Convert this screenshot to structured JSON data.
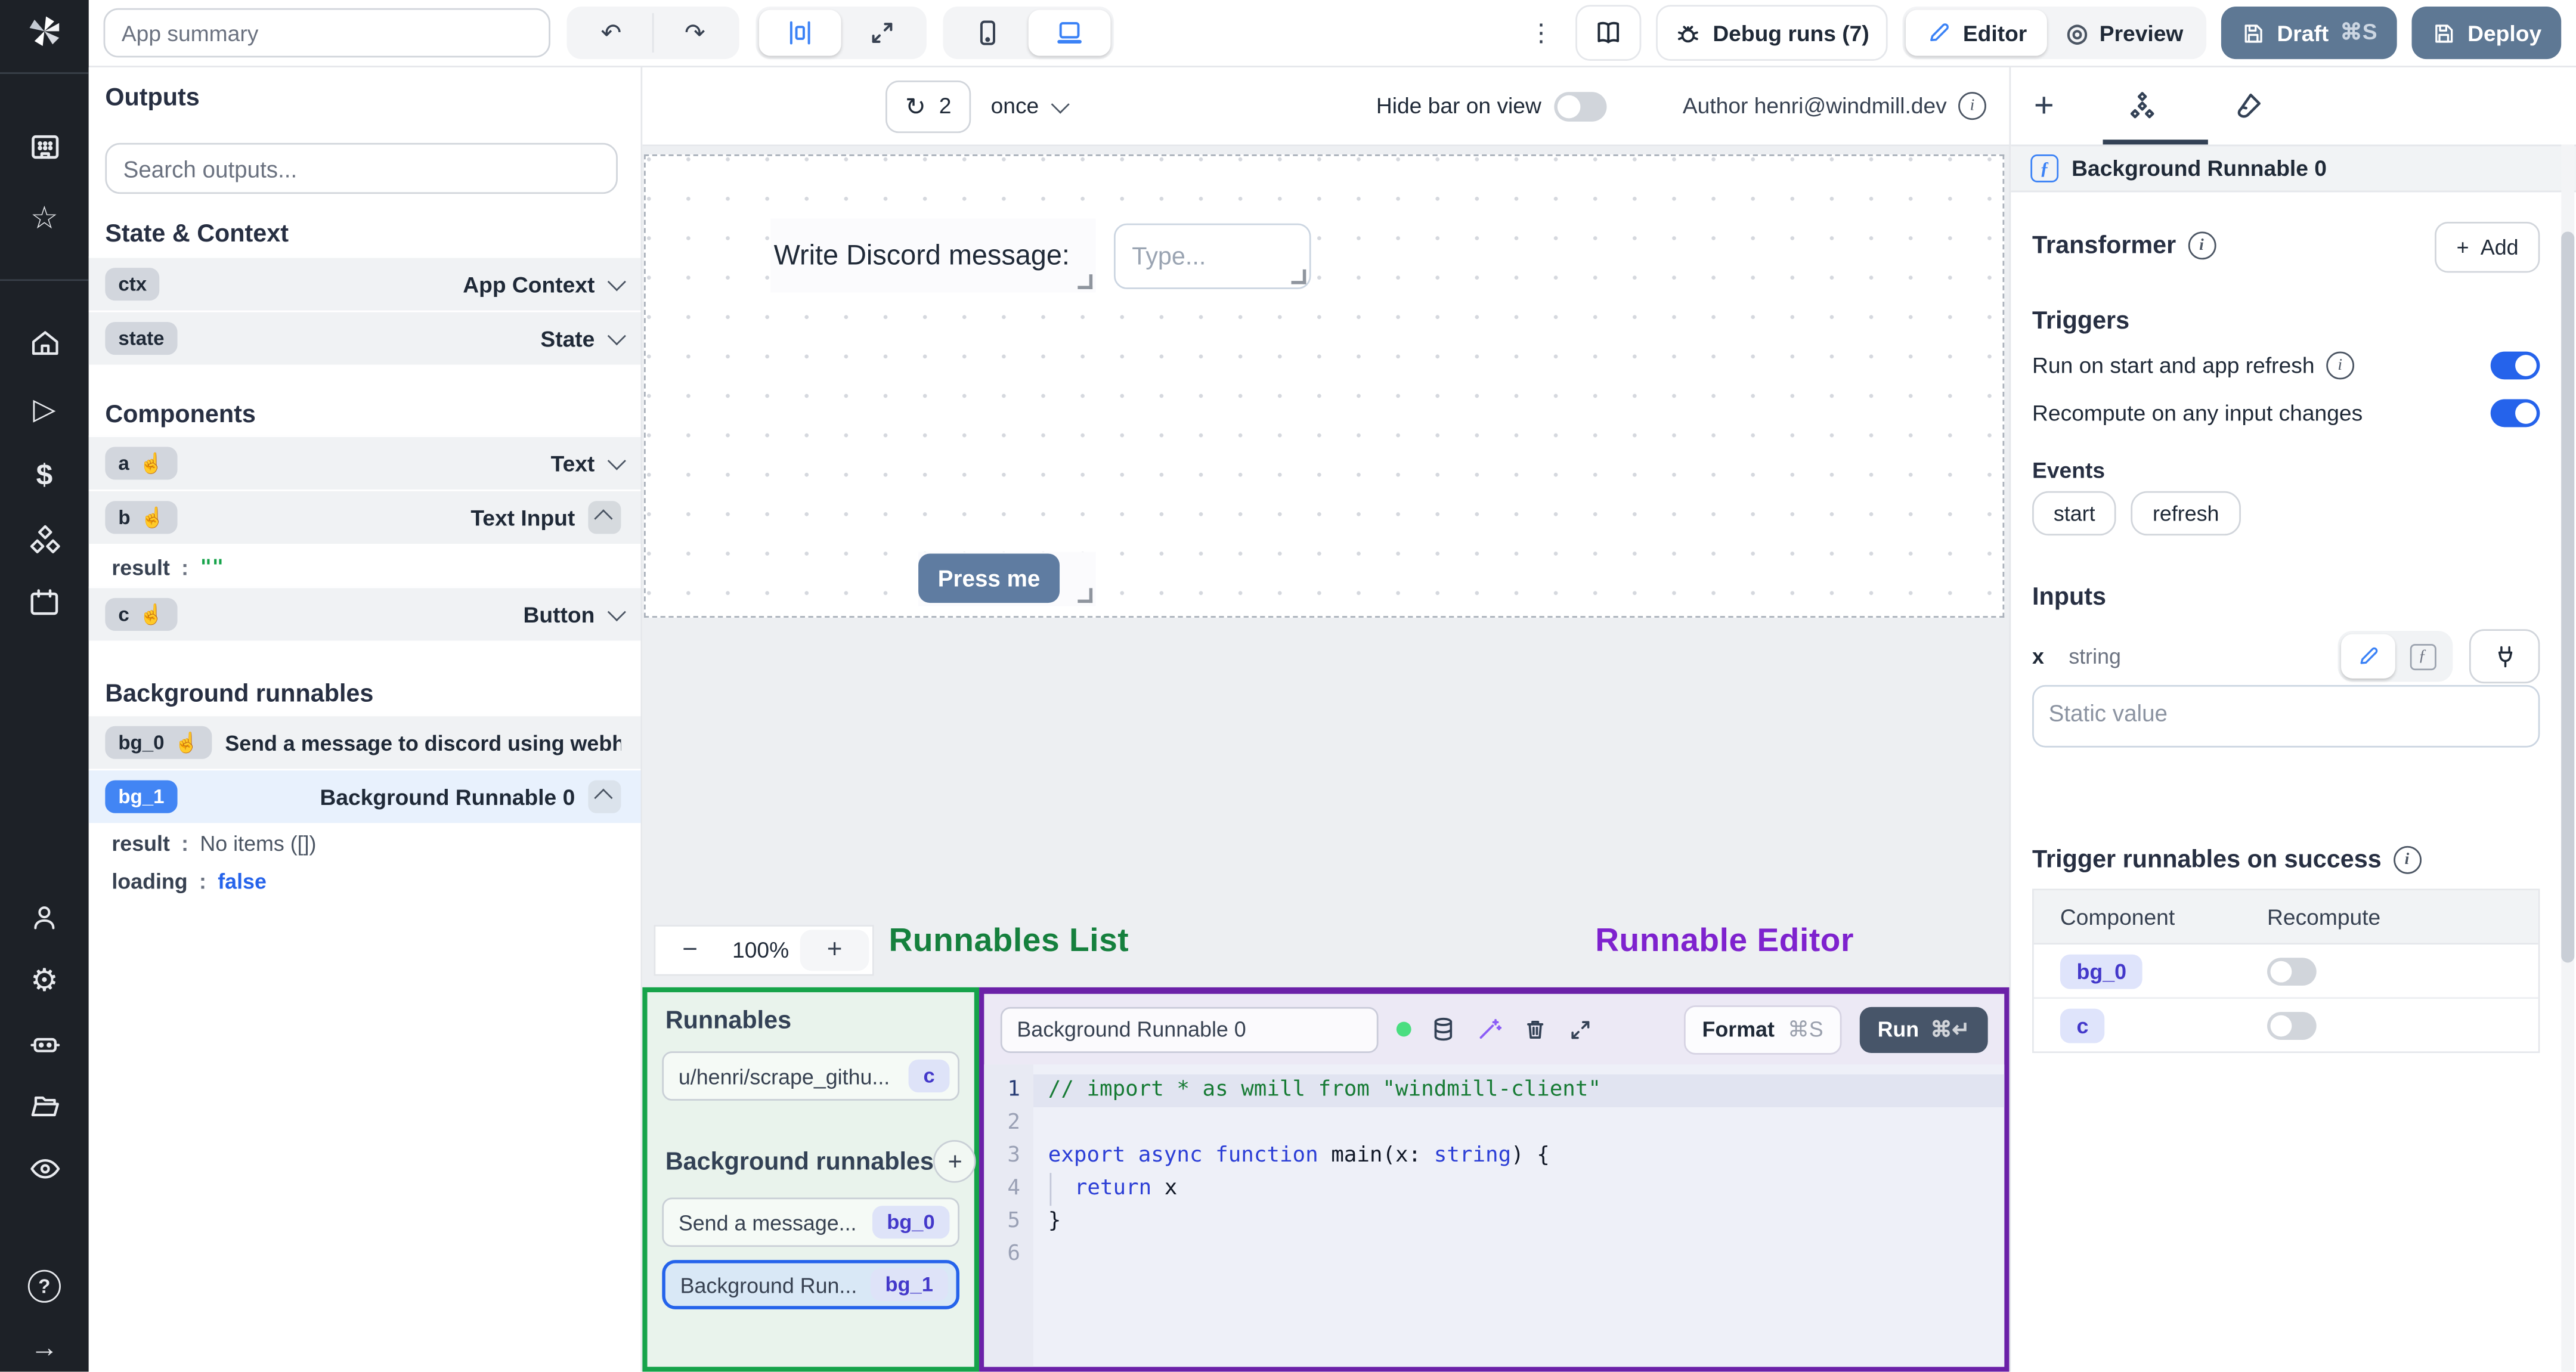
{
  "colors": {
    "accent_blue": "#2563eb",
    "badge_blue": "#4285f4",
    "annotation_green": "#15803d",
    "annotation_purple": "#7e22ce",
    "draft_button": "#5e7894",
    "run_button": "#475569",
    "press_me_button": "#5f7ca1"
  },
  "rail": {
    "icons": [
      "windmill-logo",
      "app-window",
      "star",
      "home",
      "play",
      "dollar",
      "cubes",
      "calendar",
      "user",
      "gear",
      "robot",
      "folder",
      "eye",
      "help",
      "arrow-right"
    ],
    "help_glyph": "?",
    "arrow_glyph": "→"
  },
  "topbar": {
    "app_summary_placeholder": "App summary",
    "undo_glyph": "↶",
    "redo_glyph": "↷",
    "kebab_glyph": "⋮",
    "debug_runs_label": "Debug runs (7)",
    "editor_label": "Editor",
    "preview_label": "Preview",
    "preview_glyph": "◎",
    "draft_label": "Draft",
    "draft_shortcut": "⌘S",
    "deploy_label": "Deploy"
  },
  "outputs": {
    "title": "Outputs",
    "search_placeholder": "Search outputs...",
    "state_context_title": "State & Context",
    "components_title": "Components",
    "background_title": "Background runnables",
    "hand_glyph": "☝",
    "state_rows": [
      {
        "id": "ctx",
        "type": "App Context"
      },
      {
        "id": "state",
        "type": "State"
      }
    ],
    "component_rows": [
      {
        "id": "a",
        "type": "Text"
      },
      {
        "id": "b",
        "type": "Text Input"
      },
      {
        "id": "c",
        "type": "Button"
      }
    ],
    "b_result": {
      "key": "result",
      "colon": ":",
      "value": "\"\""
    },
    "bg_rows": [
      {
        "id": "bg_0",
        "name": "Send a message to discord using webhoo"
      },
      {
        "id": "bg_1",
        "name": "Background Runnable 0"
      }
    ],
    "bg1_details": [
      {
        "key": "result",
        "colon": ":",
        "value": "No items ([])"
      },
      {
        "key": "loading",
        "colon": ":",
        "value": "false"
      }
    ]
  },
  "canvas_bar": {
    "refresh_glyph": "↻",
    "refresh_count": "2",
    "frequency": "once",
    "hide_bar_label": "Hide bar on view",
    "author": "Author henri@windmill.dev",
    "info_glyph": "i"
  },
  "canvas": {
    "text_component": "Write Discord message:",
    "input_placeholder": "Type...",
    "button_label": "Press me"
  },
  "zoom": {
    "minus": "−",
    "level": "100%",
    "plus": "+"
  },
  "annotations": {
    "list_label": "Runnables List",
    "editor_label": "Runnable Editor"
  },
  "runnables": {
    "title": "Runnables",
    "item1": {
      "name": "u/henri/scrape_githu...",
      "badge": "c"
    },
    "background_title": "Background runnables",
    "plus_glyph": "+",
    "item2": {
      "name": "Send a message...",
      "badge": "bg_0"
    },
    "item3": {
      "name": "Background Run...",
      "badge": "bg_1"
    }
  },
  "editor": {
    "name_value": "Background Runnable 0",
    "format_label": "Format",
    "format_shortcut": "⌘S",
    "run_label": "Run",
    "run_shortcut": "⌘↵",
    "line_numbers": [
      "1",
      "2",
      "3",
      "4",
      "5",
      "6"
    ],
    "code": {
      "line1": "// import * as wmill from \"windmill-client\"",
      "l3_export": "export ",
      "l3_async": "async ",
      "l3_function": "function ",
      "l3_main": "main(x: ",
      "l3_string": "string",
      "l3_close": ") {",
      "l4_return": "return ",
      "l4_x": "x",
      "l5": "}"
    }
  },
  "right": {
    "plus_tab": "+",
    "header_title": "Background Runnable 0",
    "ficon_glyph": "ƒ",
    "transformer_title": "Transformer",
    "add_plus": "+",
    "add_label": "Add",
    "triggers_title": "Triggers",
    "trigger_run_label": "Run on start and app refresh",
    "trigger_recompute_label": "Recompute on any input changes",
    "events_title": "Events",
    "event_chips": [
      "start",
      "refresh"
    ],
    "inputs_title": "Inputs",
    "input_name": "x",
    "input_type": "string",
    "static_placeholder": "Static value",
    "success_title": "Trigger runnables on success",
    "table_headers": [
      "Component",
      "Recompute"
    ],
    "table_rows": [
      {
        "component": "bg_0"
      },
      {
        "component": "c"
      }
    ]
  }
}
